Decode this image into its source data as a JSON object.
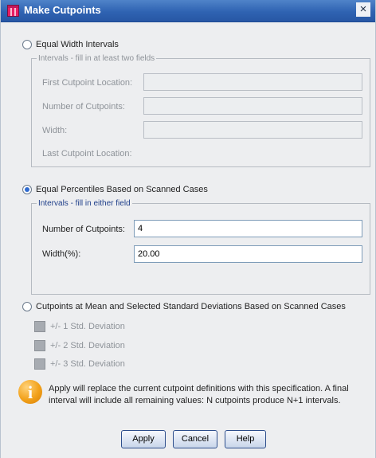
{
  "window": {
    "title": "Make Cutpoints",
    "close_glyph": "×"
  },
  "equal_width": {
    "label": "Equal Width Intervals",
    "group_label": "Intervals - fill in at least two fields",
    "first_cutpoint_label": "First Cutpoint Location:",
    "number_of_cutpoints_label": "Number of Cutpoints:",
    "width_label": "Width:",
    "last_cutpoint_label": "Last Cutpoint Location:"
  },
  "equal_percentiles": {
    "label": "Equal Percentiles Based on Scanned Cases",
    "group_label": "Intervals - fill in either field",
    "number_of_cutpoints_label": "Number of Cutpoints:",
    "number_of_cutpoints_value": "4",
    "width_label": "Width(%):",
    "width_value": "20.00"
  },
  "std_dev": {
    "label": "Cutpoints at Mean and Selected Standard Deviations Based on Scanned Cases",
    "options": [
      "+/- 1 Std. Deviation",
      "+/- 2 Std. Deviation",
      "+/- 3 Std. Deviation"
    ]
  },
  "info": {
    "text": "Apply will replace the current cutpoint definitions with this specification. A final interval will include all remaining values: N cutpoints produce N+1 intervals."
  },
  "buttons": {
    "apply": "Apply",
    "cancel": "Cancel",
    "help": "Help"
  },
  "colors": {
    "title_bar": "#2f63b2",
    "selected_radio": "#2f6bd0",
    "info_icon": "#f2a11a"
  }
}
